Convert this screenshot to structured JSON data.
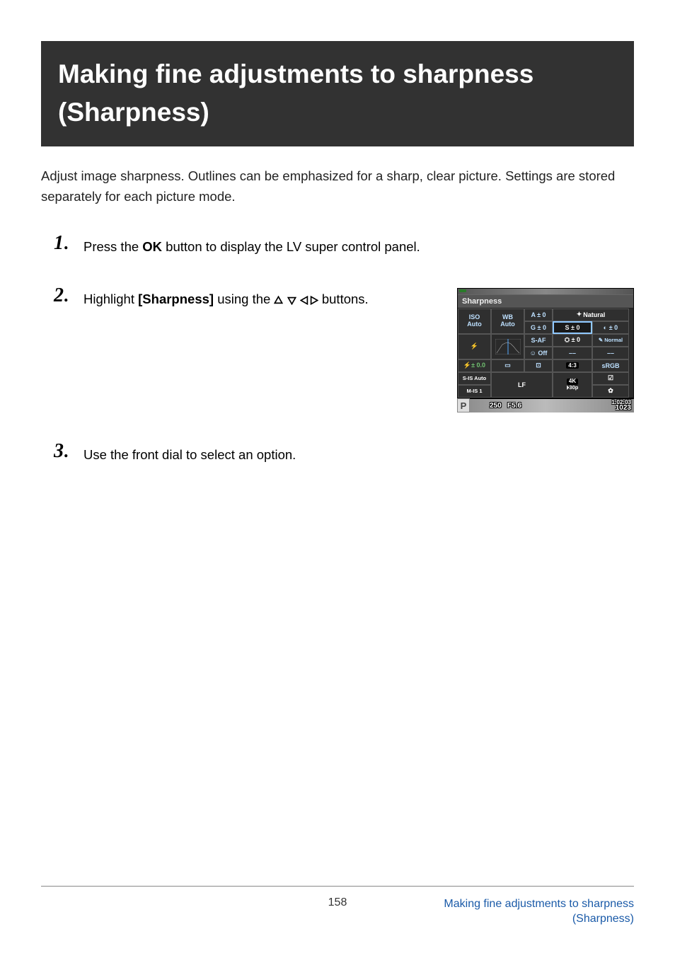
{
  "title": {
    "line1": "Making fine adjustments to sharpness",
    "line2": "(Sharpness)"
  },
  "intro": "Adjust image sharpness. Outlines can be emphasized for a sharp, clear picture. Settings are stored separately for each picture mode.",
  "steps": {
    "s1": {
      "num": "1",
      "pre": "Press the ",
      "bold": "OK",
      "post": " button to display the LV super control panel."
    },
    "s2": {
      "num": "2",
      "pre": "Highlight ",
      "bold": "[Sharpness]",
      "post": " using the ",
      "tail": " buttons."
    },
    "s3": {
      "num": "3",
      "text": "Use the front dial to select an option."
    }
  },
  "lv": {
    "header": "Sharpness",
    "r1c1a": "ISO",
    "r1c1b": "Auto",
    "r1c2a": "WB",
    "r1c2b": "Auto",
    "r1c3a": "A ± 0",
    "r1c3b": "G ± 0",
    "r1c4": "Natural",
    "r2c4": "S ± 0",
    "r2c5": "◐ ± 0",
    "r3c1": "⚡",
    "r3c3a": "S-AF",
    "r3c3b": "☺ Off",
    "r3c4": "⛭ ± 0",
    "r3c5": "✎ Normal",
    "r4c4": "––",
    "r4c5": "––",
    "r5c1": "⚡± 0.0",
    "r5c2": "▭",
    "r5c3": "⊡",
    "r5c4": "4:3",
    "r5c5": "sRGB",
    "r6c1": "S-IS Auto",
    "r6c2": "LF",
    "r6c4a": "4K",
    "r6c4b": "⏵30p",
    "r6c5": "☑",
    "r7c1": "M-IS 1",
    "r7c5": "✿",
    "bottom": {
      "mode": "P",
      "shutter": "250",
      "fstop": "F5.6",
      "time": "1:02:03",
      "count": "1023"
    }
  },
  "footer": {
    "page": "158",
    "link1": "Making fine adjustments to sharpness",
    "link2": "(Sharpness)"
  }
}
